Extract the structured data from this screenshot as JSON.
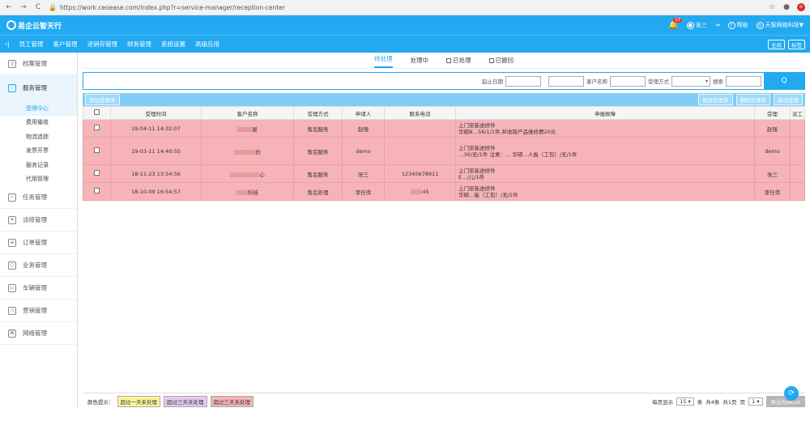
{
  "browser": {
    "url": "https://work.ceoease.com/index.php?r=service-manager/reception-center"
  },
  "header": {
    "logo": "易企云智天行",
    "notify_count": "17",
    "user": "张三",
    "help": "帮助",
    "company": "天智网络科技▼"
  },
  "menu": {
    "items": [
      "员工管理",
      "客户管理",
      "进销存管理",
      "财务管理",
      "系统设置",
      "高级应用"
    ],
    "right": [
      "全局",
      "标签"
    ]
  },
  "sidebar": {
    "items": [
      {
        "label": "档案管理",
        "icon": "file-icon"
      },
      {
        "label": "服务管理",
        "icon": "heart-icon",
        "active": true
      }
    ],
    "subitems": [
      "受理中心",
      "费用催收",
      "物流追踪",
      "发票开票",
      "服务记录",
      "代用管理"
    ],
    "bottom_items": [
      {
        "label": "任务管理",
        "icon": "clipboard-icon"
      },
      {
        "label": "派修管理",
        "icon": "tools-icon"
      },
      {
        "label": "订单管理",
        "icon": "order-icon"
      },
      {
        "label": "业务管理",
        "icon": "cycle-icon"
      },
      {
        "label": "车辆管理",
        "icon": "car-icon"
      },
      {
        "label": "营销管理",
        "icon": "megaphone-icon"
      },
      {
        "label": "网络管理",
        "icon": "network-icon"
      }
    ]
  },
  "tabs": [
    "待处理",
    "处理中",
    "已处理",
    "已撤回"
  ],
  "search": {
    "date_label": "起止日期",
    "customer_label": "客户名称",
    "method_label": "受理方式",
    "keyword_label": "搜索",
    "button": "Q"
  },
  "toolbar": {
    "left": "添加受理单",
    "right": [
      "修改受理单",
      "删除受理单",
      "指派受理"
    ]
  },
  "table": {
    "headers": [
      "",
      "受理时间",
      "客户名称",
      "受理方式",
      "申请人",
      "联系电话",
      "申报故障",
      "受理",
      "派工"
    ],
    "rows": [
      {
        "time": "19-04-11 14:32:07",
        "customer": "屋",
        "method": "售后服务",
        "applicant": "赵强",
        "phone": "",
        "fault1": "上门安装送修件",
        "fault2": "华硕B…56/1/1件,并收取产品维修费20元",
        "handler": "赵强"
      },
      {
        "time": "19-03-11 14:40:55",
        "customer": "份",
        "method": "售后服务",
        "applicant": "demo",
        "phone": "",
        "fault1": "上门安装送修件",
        "fault2": "…30/无/1件  注意：…  华硕…人板（工包）/无/1件",
        "handler": "demo"
      },
      {
        "time": "18-11-23 13:54:56",
        "customer": "心",
        "method": "售后服务",
        "applicant": "张三",
        "phone": "12345678911",
        "fault1": "上门安装送修件",
        "fault2": "E…/儿/1件",
        "handler": "张三"
      },
      {
        "time": "18-10-09 16:54:57",
        "customer": "科技",
        "method": "售后处理",
        "applicant": "李任伟",
        "phone": "45",
        "fault1": "上门安装送修件",
        "fault2": "华硕…板（工包）/无/1件",
        "handler": "李任伟"
      }
    ]
  },
  "footer": {
    "legend_label": "颜色提示：",
    "legends": [
      {
        "text": "超过一天未处理",
        "color": "#fdf59b"
      },
      {
        "text": "超过三天未处理",
        "color": "#e6c7f2"
      },
      {
        "text": "超过三天未处理",
        "color": "#f6b3b8"
      }
    ],
    "per_page_label": "每页显示",
    "per_page": "15",
    "unit": "条",
    "total": "共4条",
    "pages": "共1页",
    "page_label": "页",
    "page": "1",
    "export": "导出为excel"
  }
}
